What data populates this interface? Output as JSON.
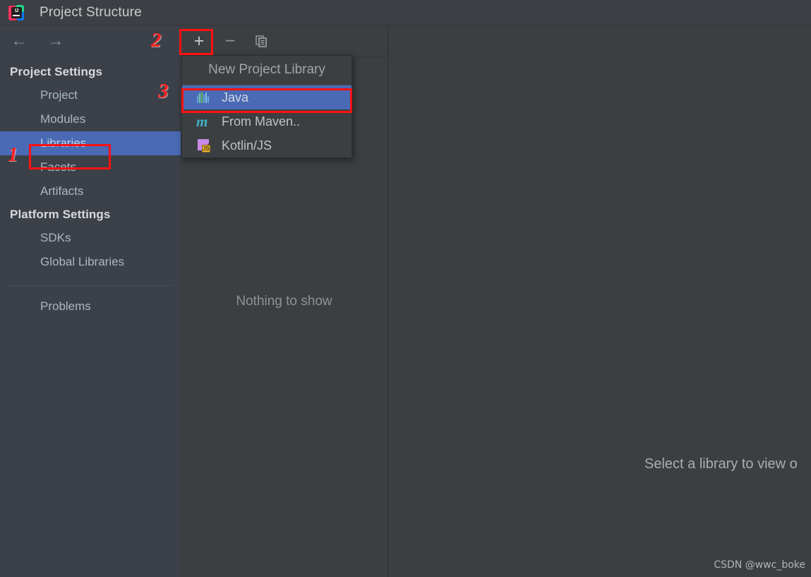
{
  "window": {
    "title": "Project Structure",
    "logo_icon": "intellij-idea-logo"
  },
  "nav": {
    "back_icon": "arrow-left-icon",
    "back_glyph": "←",
    "forward_icon": "arrow-right-icon",
    "forward_glyph": "→"
  },
  "sidebar": {
    "groups": [
      {
        "header": "Project Settings",
        "items": [
          {
            "label": "Project",
            "selected": false
          },
          {
            "label": "Modules",
            "selected": false
          },
          {
            "label": "Libraries",
            "selected": true
          },
          {
            "label": "Facets",
            "selected": false
          },
          {
            "label": "Artifacts",
            "selected": false
          }
        ]
      },
      {
        "header": "Platform Settings",
        "items": [
          {
            "label": "SDKs",
            "selected": false
          },
          {
            "label": "Global Libraries",
            "selected": false
          }
        ]
      }
    ],
    "footer_items": [
      {
        "label": "Problems",
        "selected": false
      }
    ]
  },
  "toolbar": {
    "add_label": "+",
    "add_icon": "plus-icon",
    "remove_label": "−",
    "remove_icon": "minus-icon",
    "copy_icon": "copy-icon"
  },
  "middle_panel": {
    "empty_text": "Nothing to show"
  },
  "right_panel": {
    "placeholder_text": "Select a library to view o",
    "watermark": "CSDN @wwc_boke"
  },
  "popup": {
    "title": "New Project Library",
    "items": [
      {
        "label": "Java",
        "icon": "java-library-icon",
        "highlighted": true
      },
      {
        "label": "From Maven..",
        "icon": "maven-icon",
        "highlighted": false
      },
      {
        "label": "Kotlin/JS",
        "icon": "kotlin-js-icon",
        "highlighted": false
      }
    ]
  },
  "annotations": {
    "step1": "1",
    "step2": "2",
    "step3": "3",
    "highlight_color": "#fd1111"
  }
}
